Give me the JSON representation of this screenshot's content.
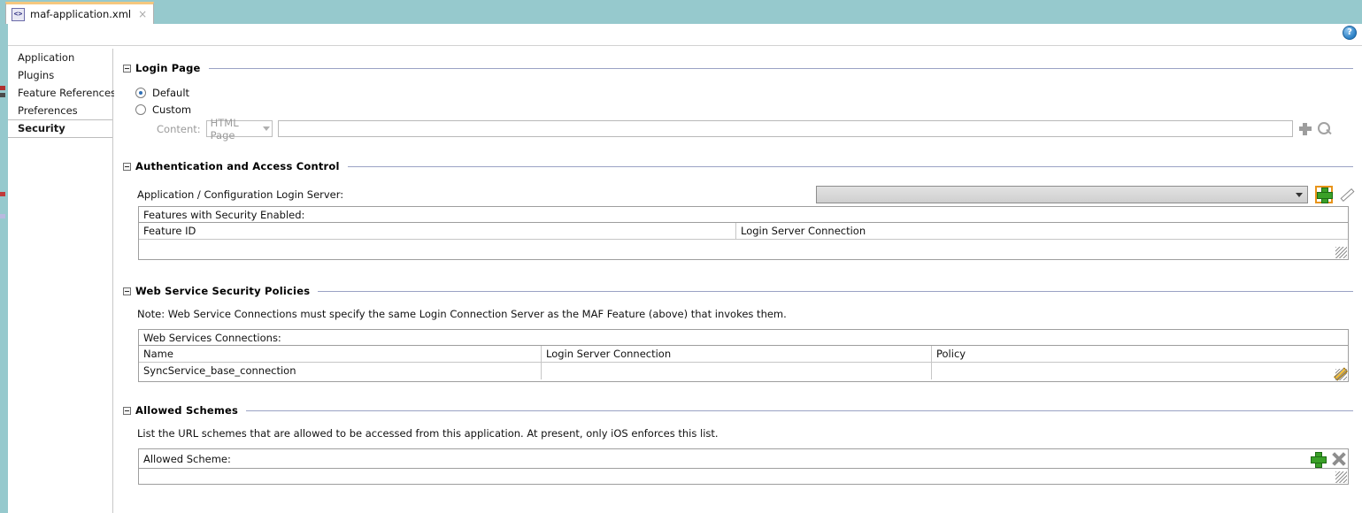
{
  "window": {
    "tab": {
      "label": "maf-application.xml",
      "icon": "xml-file-icon",
      "close_label": "×"
    },
    "help_label": "?"
  },
  "sidebar": {
    "items": [
      {
        "label": "Application",
        "selected": false
      },
      {
        "label": "Plugins",
        "selected": false
      },
      {
        "label": "Feature References",
        "selected": false
      },
      {
        "label": "Preferences",
        "selected": false
      },
      {
        "label": "Security",
        "selected": true
      }
    ]
  },
  "login_page": {
    "title": "Login Page",
    "default_label": "Default",
    "custom_label": "Custom",
    "default_selected": true,
    "custom_selected": false,
    "content_label": "Content:",
    "content_type": "HTML Page",
    "content_value": "",
    "add_icon": "plus-icon",
    "browse_icon": "magnifier-icon"
  },
  "auth": {
    "title": "Authentication and Access Control",
    "server_label": "Application / Configuration Login Server:",
    "server_value": "",
    "add_icon": "plus-icon",
    "edit_icon": "pencil-icon",
    "features_panel_title": "Features with Security Enabled:",
    "features_columns": [
      "Feature ID",
      "Login Server Connection"
    ],
    "features_rows": []
  },
  "web_service": {
    "title": "Web Service Security Policies",
    "note": "Note: Web Service Connections must specify the same Login Connection Server as the MAF Feature (above) that invokes them.",
    "panel_title": "Web Services Connections:",
    "columns": [
      "Name",
      "Login Server Connection",
      "Policy"
    ],
    "rows": [
      {
        "name": "SyncService_base_connection",
        "login_server_connection": "",
        "policy": ""
      }
    ],
    "edit_icon": "pencil-edit-icon"
  },
  "allowed_schemes": {
    "title": "Allowed Schemes",
    "description": "List the URL schemes that are allowed to be accessed from this application.  At present, only iOS enforces this list.",
    "panel_title": "Allowed Scheme:",
    "add_icon": "plus-icon",
    "delete_icon": "x-delete-icon",
    "rows": []
  },
  "colors": {
    "teal_header": "#96c9cd",
    "tab_accent": "#f5c77e",
    "section_rule": "#9aa2c4",
    "plus_green": "#3aa028",
    "focus_orange": "#e8941a",
    "help_blue": "#2a7fc4"
  }
}
